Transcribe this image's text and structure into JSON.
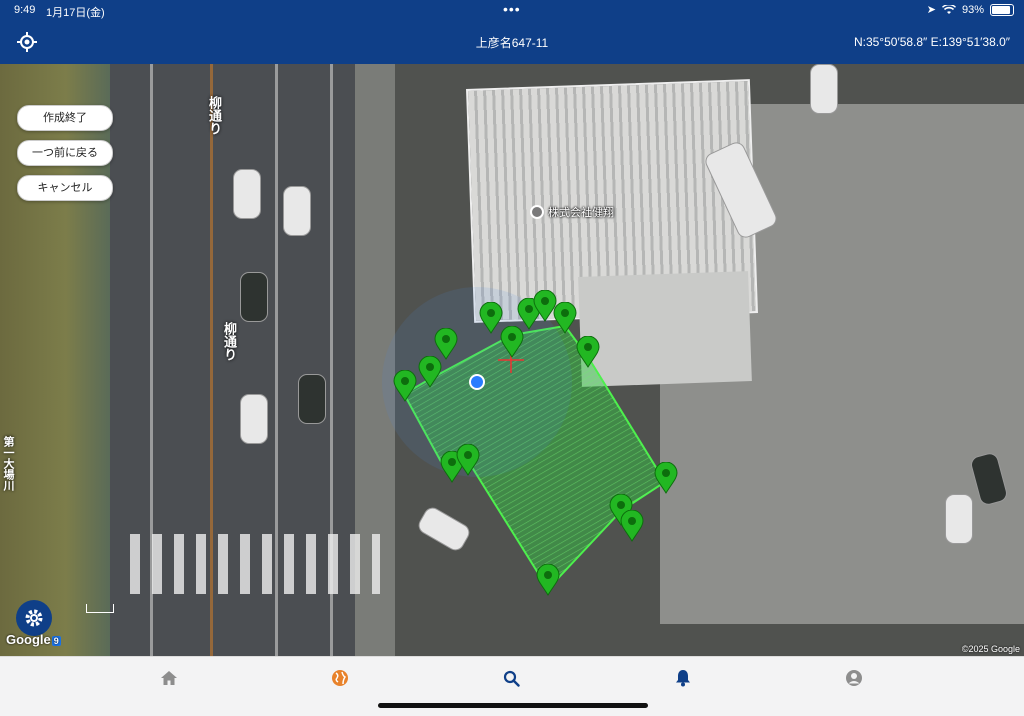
{
  "status": {
    "time": "9:49",
    "date": "1月17日(金)",
    "battery": "93%"
  },
  "appbar": {
    "title": "上彦名647-11",
    "coords": "N:35°50′58.8″ E:139°51′38.0″"
  },
  "map": {
    "road_label_1": "柳通り",
    "road_label_2": "柳通り",
    "road_label_3": "第一大場川",
    "place_label": "株式会社健翔",
    "google_logo": "Google",
    "google_badge": "9",
    "copyright": "©2025 Google"
  },
  "buttons": {
    "finish": "作成終了",
    "undo": "一つ前に戻る",
    "cancel": "キャンセル"
  },
  "tabs": [
    {
      "name": "home",
      "color": "#8d8d8d"
    },
    {
      "name": "explore",
      "color": "#e8822b"
    },
    {
      "name": "search",
      "color": "#0f3f88"
    },
    {
      "name": "notifications",
      "color": "#0f3f88"
    },
    {
      "name": "profile",
      "color": "#8d8d8d"
    }
  ],
  "colors": {
    "primary": "#0f3f88",
    "polygon": "#2ecc40",
    "marker": "#22b722"
  }
}
